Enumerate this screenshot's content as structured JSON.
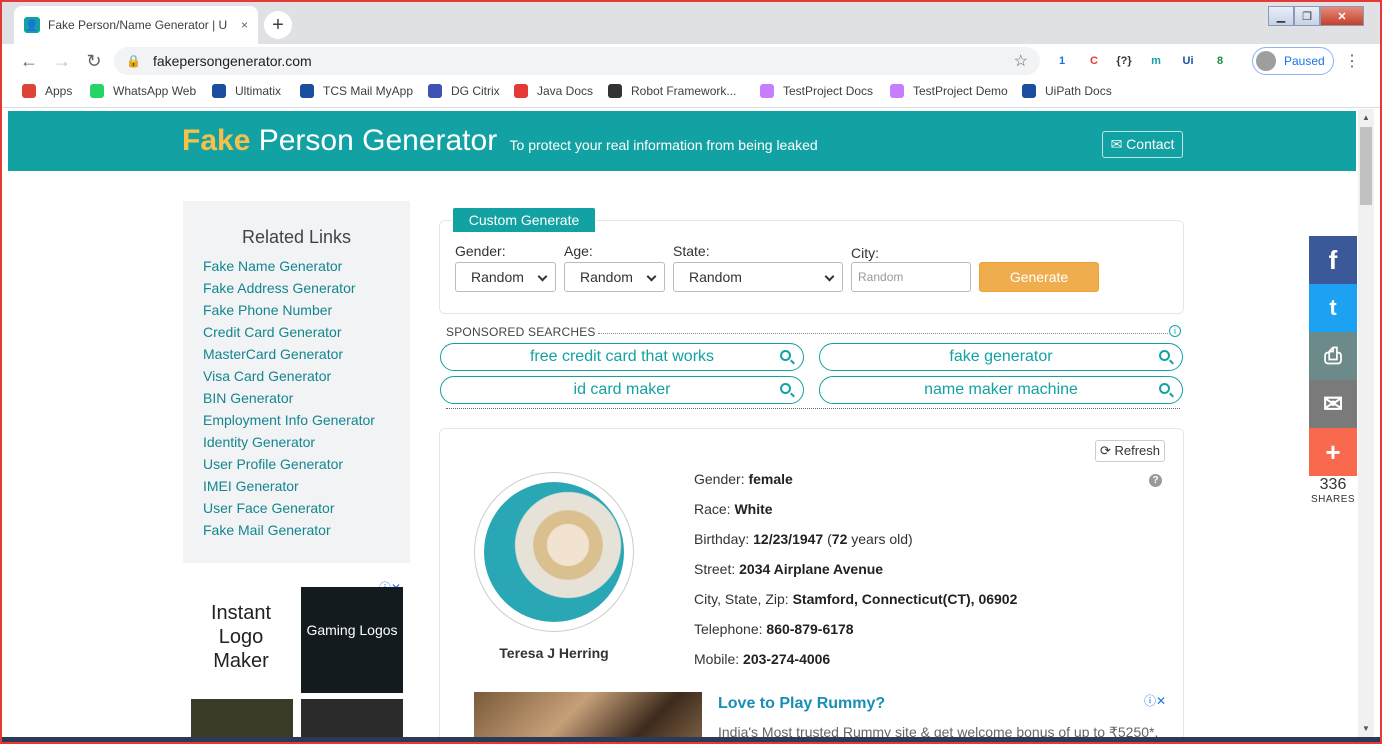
{
  "browser": {
    "tab_title": "Fake Person/Name Generator | U",
    "tab_close": "×",
    "new_tab": "+",
    "url": "fakepersongenerator.com",
    "profile_status": "Paused",
    "extensions": [
      {
        "name": "extension-badge-1",
        "label": "1",
        "color": "#1a73e8"
      },
      {
        "name": "extension-c",
        "label": "C",
        "color": "#e53935"
      },
      {
        "name": "extension-json",
        "label": "{?}",
        "color": "#333333"
      },
      {
        "name": "extension-m",
        "label": "m",
        "color": "#13a2a3"
      },
      {
        "name": "extension-ui",
        "label": "Ui",
        "color": "#1a4fa0"
      },
      {
        "name": "extension-shield-8",
        "label": "8",
        "color": "#1e8e3e"
      }
    ],
    "bookmarks": [
      {
        "label": "Apps",
        "color": "#db4437"
      },
      {
        "label": "WhatsApp Web",
        "color": "#25d366"
      },
      {
        "label": "Ultimatix",
        "color": "#1a4fa0"
      },
      {
        "label": "TCS Mail MyApp",
        "color": "#1a4fa0"
      },
      {
        "label": "DG Citrix",
        "color": "#3f51b5"
      },
      {
        "label": "Java Docs",
        "color": "#e53935"
      },
      {
        "label": "Robot Framework...",
        "color": "#333333"
      },
      {
        "label": "TestProject Docs",
        "color": "#c77dff"
      },
      {
        "label": "TestProject Demo",
        "color": "#c77dff"
      },
      {
        "label": "UiPath Docs",
        "color": "#1a4fa0"
      }
    ]
  },
  "header": {
    "brand_first": "Fake",
    "brand_rest": "Person Generator",
    "tagline": "To protect your real information from being leaked",
    "contact": "✉ Contact"
  },
  "sidebar": {
    "title": "Related Links",
    "links": [
      "Fake Name Generator",
      "Fake Address Generator",
      "Fake Phone Number",
      "Credit Card Generator",
      "MasterCard Generator",
      "Visa Card Generator",
      "BIN Generator",
      "Employment Info Generator",
      "Identity Generator",
      "User Profile Generator",
      "IMEI Generator",
      "User Face Generator",
      "Fake Mail Generator"
    ],
    "ad": {
      "tile1": "Instant Logo Maker",
      "tile2": "Gaming Logos",
      "badge": "ⓘ✕"
    }
  },
  "form": {
    "tab": "Custom Generate",
    "gender_label": "Gender:",
    "gender_value": "Random",
    "age_label": "Age:",
    "age_value": "Random",
    "state_label": "State:",
    "state_value": "Random",
    "city_label": "City:",
    "city_placeholder": "Random",
    "generate": "Generate"
  },
  "sponsored": {
    "title": "SPONSORED SEARCHES",
    "info": "i",
    "searches": [
      "free credit card that works",
      "fake generator",
      "id card maker",
      "name maker machine"
    ]
  },
  "person": {
    "refresh": "⟳ Refresh",
    "help": "?",
    "name": "Teresa J Herring",
    "gender_label": "Gender:",
    "gender": "female",
    "race_label": "Race:",
    "race": "White",
    "birthday_label": "Birthday:",
    "birthday": "12/23/1947",
    "age_open": " (",
    "age": "72",
    "age_suffix": " years old)",
    "street_label": "Street:",
    "street": "2034 Airplane Avenue",
    "csz_label": "City, State, Zip:",
    "csz": "Stamford, Connecticut(CT), 06902",
    "telephone_label": "Telephone:",
    "telephone": "860-879-6178",
    "mobile_label": "Mobile:",
    "mobile": "203-274-4006"
  },
  "bottom_ad": {
    "headline": "Love to Play Rummy?",
    "text": "India's Most trusted Rummy site & get welcome bonus of up to ₹5250*.",
    "badge": "ⓘ✕"
  },
  "share": {
    "facebook": "f",
    "twitter": "t",
    "print": "⎙",
    "email": "✉",
    "more": "+",
    "count": "336",
    "label": "SHARES",
    "colors": {
      "facebook": "#3b5998",
      "twitter": "#1da1f2",
      "print": "#6d8a8a",
      "email": "#7a7a7a",
      "more": "#f8694d"
    }
  }
}
